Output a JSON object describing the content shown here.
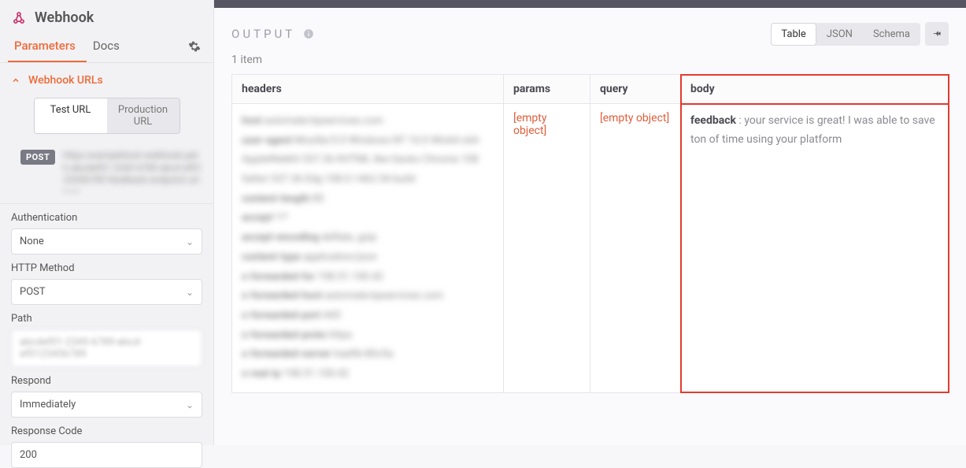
{
  "panel": {
    "title": "Webhook",
    "tabs": {
      "parameters": "Parameters",
      "docs": "Docs"
    },
    "webhook_urls_label": "Webhook URLs",
    "url_mode": {
      "test": "Test URL",
      "production": "Production URL"
    },
    "method_badge": "POST",
    "fields": {
      "authentication": {
        "label": "Authentication",
        "value": "None"
      },
      "http_method": {
        "label": "HTTP Method",
        "value": "POST"
      },
      "path": {
        "label": "Path",
        "value": ""
      },
      "respond": {
        "label": "Respond",
        "value": "Immediately"
      },
      "response_code": {
        "label": "Response Code",
        "value": "200"
      }
    }
  },
  "output": {
    "title": "OUTPUT",
    "views": {
      "table": "Table",
      "json": "JSON",
      "schema": "Schema"
    },
    "item_count": "1 item",
    "columns": {
      "headers": "headers",
      "params": "params",
      "query": "query",
      "body": "body"
    },
    "empty_object": "[empty object]",
    "body": {
      "key": "feedback",
      "sep": " : ",
      "value": "your service is great! I was able to save ton of time using your platform"
    }
  }
}
